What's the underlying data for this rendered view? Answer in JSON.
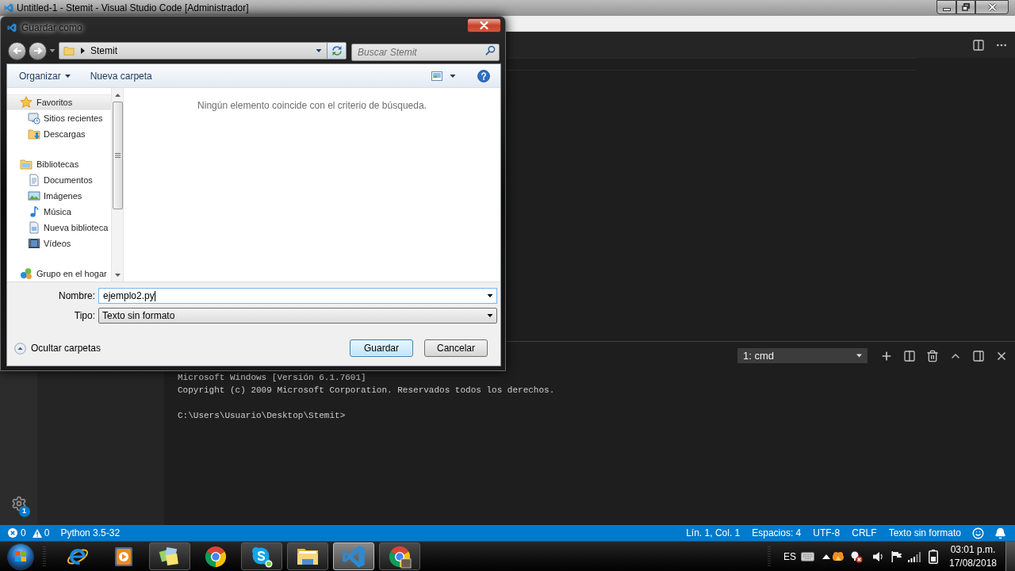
{
  "window": {
    "title": "Untitled-1 - Stemit - Visual Studio Code [Administrador]"
  },
  "dialog": {
    "title": "Guardar como",
    "address": [
      "Stemit"
    ],
    "search": {
      "placeholder": "Buscar Stemit"
    },
    "toolbar": [
      {
        "label": "Organizar",
        "kind": "menu"
      },
      {
        "label": "Nueva carpeta",
        "kind": "button"
      }
    ],
    "nav_tree": [
      {
        "label": "Favoritos",
        "selected": true,
        "children": [
          {
            "label": "Sitios recientes",
            "selected": false
          },
          {
            "label": "Descargas",
            "selected": false
          }
        ]
      },
      {
        "label": "Bibliotecas",
        "selected": false,
        "children": [
          {
            "label": "Documentos",
            "selected": false
          },
          {
            "label": "Imágenes",
            "selected": false
          },
          {
            "label": "Música",
            "selected": false
          },
          {
            "label": "Nueva biblioteca",
            "selected": false
          },
          {
            "label": "Vídeos",
            "selected": false
          }
        ]
      },
      {
        "label": "Grupo en el hogar",
        "selected": false
      }
    ],
    "empty_message": "Ningún elemento coincide con el criterio de búsqueda.",
    "filename": {
      "label": "Nombre:",
      "value": "ejemplo2.py"
    },
    "file_type": {
      "label": "Tipo:",
      "value": "Texto sin formato"
    },
    "hide_folders": "Ocultar carpetas",
    "buttons": [
      {
        "label": "Guardar",
        "kind": "default"
      },
      {
        "label": "Cancelar",
        "kind": "normal"
      }
    ]
  },
  "activity_bar": {
    "settings_badge": "1"
  },
  "terminal": {
    "selector": "1: cmd",
    "output": [
      "Microsoft Windows [Versión 6.1.7601]",
      "Copyright (c) 2009 Microsoft Corporation. Reservados todos los derechos."
    ],
    "prompt": "C:\\Users\\Usuario\\Desktop\\Stemit>"
  },
  "status_bar": {
    "errors": "0",
    "warnings": "0",
    "interpreter": "Python 3.5-32",
    "items": [
      "Lín. 1, Col. 1",
      "Espacios: 4",
      "UTF-8",
      "CRLF",
      "Texto sin formato"
    ]
  },
  "taskbar": {
    "apps": [
      {
        "running": false,
        "selected": false
      },
      {
        "running": false,
        "selected": false
      },
      {
        "running": true,
        "selected": false
      },
      {
        "running": false,
        "selected": false
      },
      {
        "running": true,
        "selected": false
      },
      {
        "running": true,
        "selected": false
      },
      {
        "running": true,
        "selected": true
      },
      {
        "running": true,
        "selected": false
      }
    ]
  },
  "tray": {
    "language": "ES",
    "time": "03:01 p.m.",
    "date": "17/08/2018"
  }
}
